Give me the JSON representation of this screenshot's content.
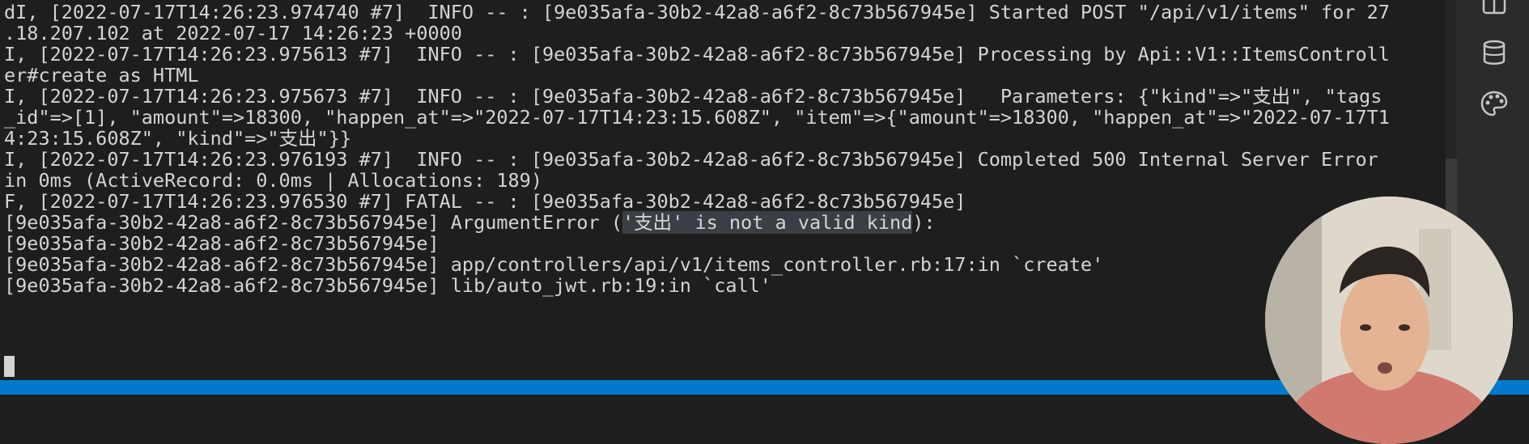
{
  "terminal": {
    "lines": [
      "dI, [2022-07-17T14:26:23.974740 #7]  INFO -- : [9e035afa-30b2-42a8-a6f2-8c73b567945e] Started POST \"/api/v1/items\" for 27",
      ".18.207.102 at 2022-07-17 14:26:23 +0000",
      "I, [2022-07-17T14:26:23.975613 #7]  INFO -- : [9e035afa-30b2-42a8-a6f2-8c73b567945e] Processing by Api::V1::ItemsControll",
      "er#create as HTML",
      "I, [2022-07-17T14:26:23.975673 #7]  INFO -- : [9e035afa-30b2-42a8-a6f2-8c73b567945e]   Parameters: {\"kind\"=>\"支出\", \"tags",
      "_id\"=>[1], \"amount\"=>18300, \"happen_at\"=>\"2022-07-17T14:23:15.608Z\", \"item\"=>{\"amount\"=>18300, \"happen_at\"=>\"2022-07-17T1",
      "4:23:15.608Z\", \"kind\"=>\"支出\"}}",
      "I, [2022-07-17T14:26:23.976193 #7]  INFO -- : [9e035afa-30b2-42a8-a6f2-8c73b567945e] Completed 500 Internal Server Error",
      "in 0ms (ActiveRecord: 0.0ms | Allocations: 189)",
      "F, [2022-07-17T14:26:23.976530 #7] FATAL -- : [9e035afa-30b2-42a8-a6f2-8c73b567945e]",
      "[9e035afa-30b2-42a8-a6f2-8c73b567945e] ArgumentError (",
      "[9e035afa-30b2-42a8-a6f2-8c73b567945e]",
      "[9e035afa-30b2-42a8-a6f2-8c73b567945e] app/controllers/api/v1/items_controller.rb:17:in `create'",
      "[9e035afa-30b2-42a8-a6f2-8c73b567945e] lib/auto_jwt.rb:19:in `call'"
    ],
    "error_highlight": "'支出' is not a valid kind",
    "error_tail": "):"
  },
  "colors": {
    "terminal_bg": "#1e1e1e",
    "terminal_text": "#d4d4d4",
    "selection_bg": "#3b3f45",
    "status_bar": "#007acc",
    "activity_bar": "#2b2b2b"
  },
  "activity_bar": {
    "icons": [
      "layout-icon",
      "database-icon",
      "palette-icon"
    ]
  }
}
